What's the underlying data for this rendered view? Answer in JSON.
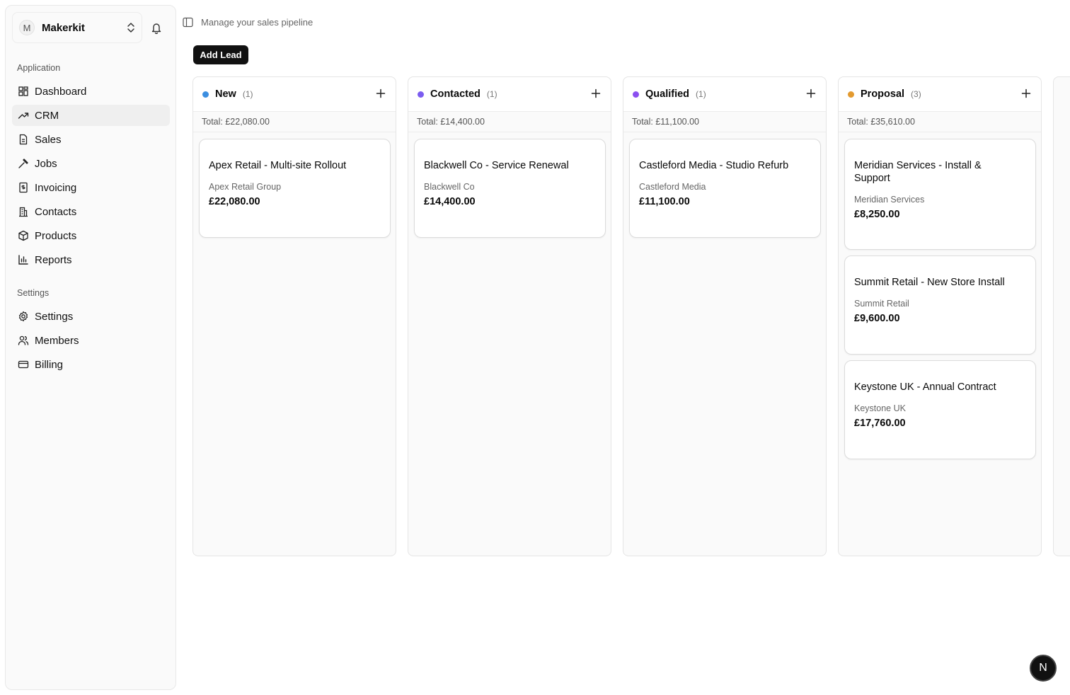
{
  "account": {
    "initial": "M",
    "name": "Makerkit"
  },
  "sidebar": {
    "groups": [
      {
        "label": "Application",
        "items": [
          {
            "label": "Dashboard",
            "icon": "dashboard-icon"
          },
          {
            "label": "CRM",
            "icon": "trending-up-icon",
            "active": true
          },
          {
            "label": "Sales",
            "icon": "document-icon"
          },
          {
            "label": "Jobs",
            "icon": "hammer-icon"
          },
          {
            "label": "Invoicing",
            "icon": "invoice-icon"
          },
          {
            "label": "Contacts",
            "icon": "building-icon"
          },
          {
            "label": "Products",
            "icon": "package-icon"
          },
          {
            "label": "Reports",
            "icon": "bar-chart-icon"
          }
        ]
      },
      {
        "label": "Settings",
        "items": [
          {
            "label": "Settings",
            "icon": "gear-icon"
          },
          {
            "label": "Members",
            "icon": "users-icon"
          },
          {
            "label": "Billing",
            "icon": "credit-card-icon"
          }
        ]
      }
    ]
  },
  "header": {
    "subtitle": "Manage your sales pipeline",
    "add_lead_label": "Add Lead"
  },
  "columns": [
    {
      "title": "New",
      "count": "(1)",
      "color": "#3b8ee0",
      "total": "Total: £22,080.00",
      "cards": [
        {
          "title": "Apex Retail - Multi-site Rollout",
          "company": "Apex Retail Group",
          "amount": "£22,080.00"
        }
      ]
    },
    {
      "title": "Contacted",
      "count": "(1)",
      "color": "#7b5cf0",
      "total": "Total: £14,400.00",
      "cards": [
        {
          "title": "Blackwell Co - Service Renewal",
          "company": "Blackwell Co",
          "amount": "£14,400.00"
        }
      ]
    },
    {
      "title": "Qualified",
      "count": "(1)",
      "color": "#8b4ff0",
      "total": "Total: £11,100.00",
      "cards": [
        {
          "title": "Castleford Media - Studio Refurb",
          "company": "Castleford Media",
          "amount": "£11,100.00"
        }
      ]
    },
    {
      "title": "Proposal",
      "count": "(3)",
      "color": "#e39a2f",
      "total": "Total: £35,610.00",
      "cards": [
        {
          "title": "Meridian Services - Install & Support",
          "company": "Meridian Services",
          "amount": "£8,250.00"
        },
        {
          "title": "Summit Retail - New Store Install",
          "company": "Summit Retail",
          "amount": "£9,600.00"
        },
        {
          "title": "Keystone UK - Annual Contract",
          "company": "Keystone UK",
          "amount": "£17,760.00"
        }
      ]
    }
  ],
  "badge": {
    "letter": "N"
  }
}
